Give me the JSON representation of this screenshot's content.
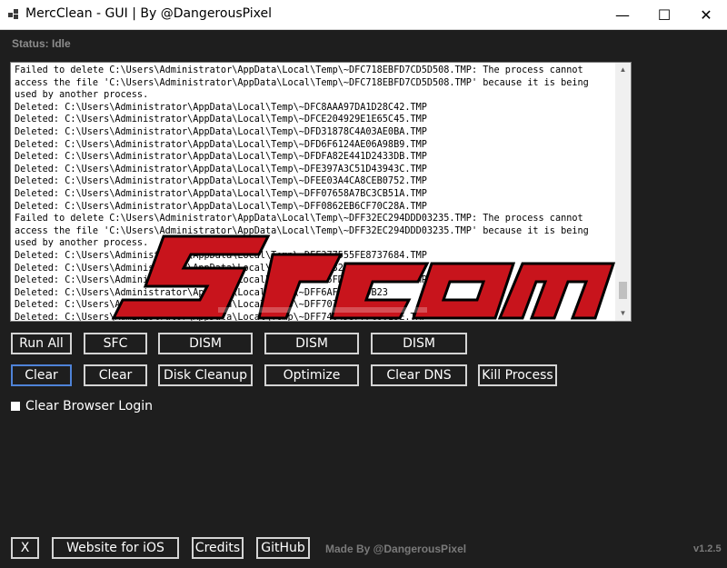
{
  "window": {
    "title": "MercClean - GUI | By @DangerousPixel",
    "minimize_glyph": "—",
    "maximize_glyph": "☐",
    "close_glyph": "✕"
  },
  "status": {
    "text": "Status: Idle"
  },
  "log": {
    "lines": [
      "Failed to delete C:\\Users\\Administrator\\AppData\\Local\\Temp\\~DFC718EBFD7CD5D508.TMP: The process cannot access the file 'C:\\Users\\Administrator\\AppData\\Local\\Temp\\~DFC718EBFD7CD5D508.TMP' because it is being used by another process.",
      "Deleted: C:\\Users\\Administrator\\AppData\\Local\\Temp\\~DFC8AAA97DA1D28C42.TMP",
      "Deleted: C:\\Users\\Administrator\\AppData\\Local\\Temp\\~DFCE204929E1E65C45.TMP",
      "Deleted: C:\\Users\\Administrator\\AppData\\Local\\Temp\\~DFD31878C4A03AE0BA.TMP",
      "Deleted: C:\\Users\\Administrator\\AppData\\Local\\Temp\\~DFD6F6124AE06A98B9.TMP",
      "Deleted: C:\\Users\\Administrator\\AppData\\Local\\Temp\\~DFDFA82E441D2433DB.TMP",
      "Deleted: C:\\Users\\Administrator\\AppData\\Local\\Temp\\~DFE397A3C51D43943C.TMP",
      "Deleted: C:\\Users\\Administrator\\AppData\\Local\\Temp\\~DFEE03A4CA8CEB0752.TMP",
      "Deleted: C:\\Users\\Administrator\\AppData\\Local\\Temp\\~DFF07658A7BC3CB51A.TMP",
      "Deleted: C:\\Users\\Administrator\\AppData\\Local\\Temp\\~DFF0862EB6CF70C28A.TMP",
      "Failed to delete C:\\Users\\Administrator\\AppData\\Local\\Temp\\~DFF32EC294DDD03235.TMP: The process cannot access the file 'C:\\Users\\Administrator\\AppData\\Local\\Temp\\~DFF32EC294DDD03235.TMP' because it is being used by another process.",
      "Deleted: C:\\Users\\Administrator\\AppData\\Local\\Temp\\~DFF377555FE8737684.TMP",
      "Deleted: C:\\Users\\Administrator\\AppData\\Local\\Temp\\~DFF5232AFA5D8621F8.TMP",
      "Deleted: C:\\Users\\Administrator\\AppData\\Local\\Temp\\~DFF55FD9F44FE8049D.TMP",
      "Deleted: C:\\Users\\Administrator\\AppData\\Local\\Temp\\~DFF6AF5A2AB9B23",
      "Deleted: C:\\Users\\Administrator\\AppData\\Local\\Temp\\~DFF70712",
      "Deleted: C:\\Users\\Administrator\\AppData\\Local\\Temp\\~DFF7484D3F7FC8013E.TMP"
    ],
    "scroll_up_glyph": "▲",
    "scroll_down_glyph": "▼"
  },
  "buttons": {
    "run_all": "Run All",
    "sfc": "SFC",
    "dism_1": "DISM",
    "dism_2": "DISM",
    "dism_3": "DISM",
    "clear_1": "Clear",
    "clear_2": "Clear",
    "disk_cleanup": "Disk Cleanup",
    "optimize": "Optimize",
    "clear_dns": "Clear DNS",
    "kill_process": "Kill Process"
  },
  "checkbox": {
    "label": "Clear Browser Login",
    "checked": false
  },
  "footer": {
    "x": "X",
    "website_ios": "Website for iOS",
    "credits": "Credits",
    "github": "GitHub",
    "made_by": "Made By @DangerousPixel",
    "version": "v1.2.5"
  },
  "colors": {
    "background": "#1e1e1e",
    "focus_border": "#4f83d8",
    "watermark": "#c8141c"
  }
}
